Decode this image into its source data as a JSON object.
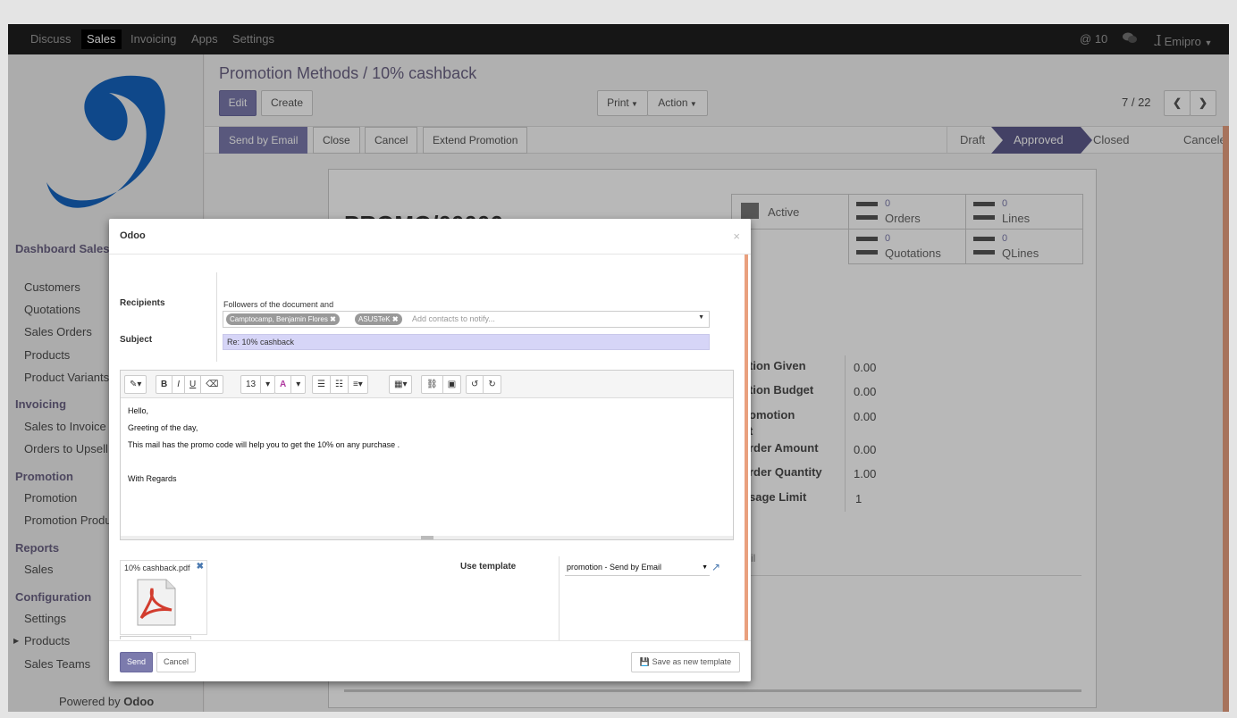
{
  "topbar": {
    "menu": [
      "Discuss",
      "Sales",
      "Invoicing",
      "Apps",
      "Settings"
    ],
    "active": "Sales",
    "mentions_count": "10",
    "user_name": "Emipro"
  },
  "sidebar": {
    "sections": [
      {
        "title": "Dashboard Sales",
        "items": [
          "Customers",
          "Quotations",
          "Sales Orders",
          "Products",
          "Product Variants"
        ]
      },
      {
        "title": "Invoicing",
        "items": [
          "Sales to Invoice",
          "Orders to Upsell"
        ]
      },
      {
        "title": "Promotion",
        "items": [
          "Promotion",
          "Promotion Products"
        ]
      },
      {
        "title": "Reports",
        "items": [
          "Sales"
        ]
      },
      {
        "title": "Configuration",
        "items": [
          "Settings",
          "Products",
          "Sales Teams"
        ]
      }
    ],
    "footer_prefix": "Powered by",
    "footer_brand": "Odoo"
  },
  "breadcrumb": {
    "parent": "Promotion Methods",
    "sep": "/",
    "current": "10% cashback"
  },
  "control": {
    "edit": "Edit",
    "create": "Create",
    "print": "Print",
    "action": "Action",
    "pager": "7 / 22"
  },
  "statusbar": {
    "buttons": [
      "Send by Email",
      "Close",
      "Cancel",
      "Extend Promotion"
    ],
    "stages": [
      "Draft",
      "Approved",
      "Closed",
      "Canceled"
    ],
    "current_stage": "Approved"
  },
  "form": {
    "name": "PROMO/00006",
    "active_label": "Active",
    "stats": [
      {
        "value": "0",
        "label": "Orders"
      },
      {
        "value": "0",
        "label": "Lines"
      },
      {
        "value": "0",
        "label": "Quotations"
      },
      {
        "value": "0",
        "label": "QLines"
      }
    ],
    "fields": [
      {
        "label": "tion Given",
        "value": "0.00"
      },
      {
        "label": "tion Budget",
        "value": "0.00"
      },
      {
        "label": "omotion",
        "label2": "t",
        "value": "0.00"
      },
      {
        "label": "rder Amount",
        "value": "0.00"
      },
      {
        "label": "rder Quantity",
        "value": "1.00"
      },
      {
        "label": "sage Limit",
        "value": "1"
      }
    ],
    "tab_fragment": "il"
  },
  "modal": {
    "title": "Odoo",
    "close": "×",
    "recipients_label": "Recipients",
    "followers_text": "Followers of the document and",
    "tags": [
      "Camptocamp, Benjamin Flores",
      "ASUSTeK"
    ],
    "contacts_placeholder": "Add contacts to notify...",
    "subject_label": "Subject",
    "subject_value": "Re: 10% cashback",
    "toolbar": {
      "font_size": "13"
    },
    "body": [
      "Hello,",
      "Greeting of the day,",
      "This mail has the promo code will help you to get the 10% on any purchase .",
      "",
      "With Regards"
    ],
    "attachment_name": "10% cashback.pdf",
    "template_label": "Use template",
    "template_value": "promotion - Send by Email",
    "send": "Send",
    "cancel": "Cancel",
    "save_template": "Save as new template"
  },
  "colors": {
    "topbar": "#1f1f1f",
    "accent": "#7c7bad",
    "breadcrumb": "#6b6384",
    "current_stage": "#5e5b8c",
    "logo_blue": "#1565c0"
  }
}
